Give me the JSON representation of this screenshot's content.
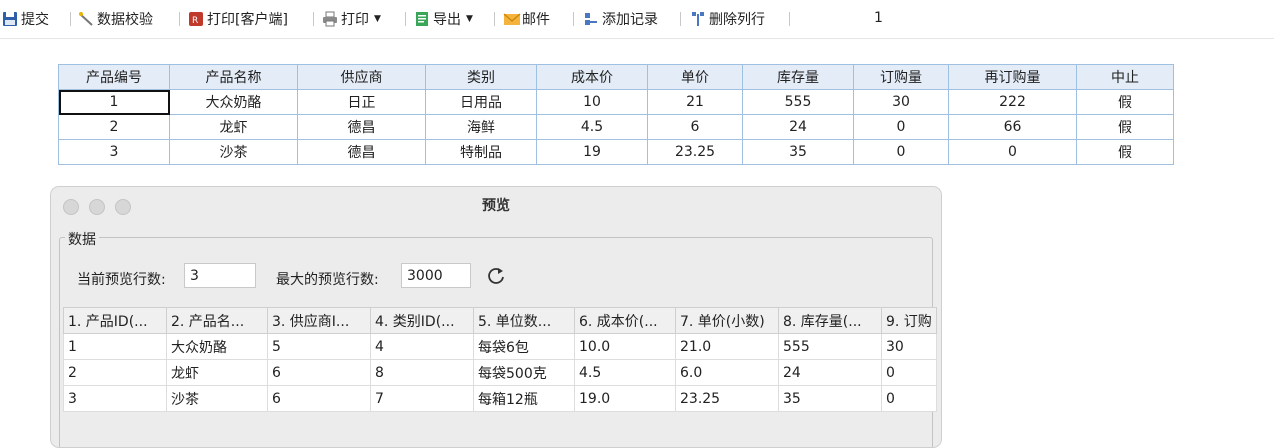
{
  "toolbar": {
    "submit": "提交",
    "validate": "数据校验",
    "print_client": "打印[客户端]",
    "print": "打印",
    "export": "导出",
    "mail": "邮件",
    "add_record": "添加记录",
    "delete_row": "删除列行",
    "page_number": "1"
  },
  "grid": {
    "headers": [
      "产品编号",
      "产品名称",
      "供应商",
      "类别",
      "成本价",
      "单价",
      "库存量",
      "订购量",
      "再订购量",
      "中止"
    ],
    "rows": [
      [
        "1",
        "大众奶酪",
        "日正",
        "日用品",
        "10",
        "21",
        "555",
        "30",
        "222",
        "假"
      ],
      [
        "2",
        "龙虾",
        "德昌",
        "海鲜",
        "4.5",
        "6",
        "24",
        "0",
        "66",
        "假"
      ],
      [
        "3",
        "沙茶",
        "德昌",
        "特制品",
        "19",
        "23.25",
        "35",
        "0",
        "0",
        "假"
      ]
    ]
  },
  "preview": {
    "title": "预览",
    "group_label": "数据",
    "current_rows_label": "当前预览行数:",
    "current_rows_value": "3",
    "max_rows_label": "最大的预览行数:",
    "max_rows_value": "3000",
    "headers": [
      "1. 产品ID(...",
      "2. 产品名...",
      "3. 供应商I...",
      "4. 类别ID(...",
      "5. 单位数...",
      "6. 成本价(...",
      "7. 单价(小数)",
      "8. 库存量(...",
      "9. 订购"
    ],
    "rows": [
      [
        "1",
        "大众奶酪",
        "5",
        "4",
        "每袋6包",
        "10.0",
        "21.0",
        "555",
        "30"
      ],
      [
        "2",
        "龙虾",
        "6",
        "8",
        "每袋500克",
        "4.5",
        "6.0",
        "24",
        "0"
      ],
      [
        "3",
        "沙茶",
        "6",
        "7",
        "每箱12瓶",
        "19.0",
        "23.25",
        "35",
        "0"
      ]
    ]
  },
  "colors": {
    "grid_border": "#9fc0e0",
    "grid_header": "#e4ecf7",
    "window_bg": "#ececec"
  }
}
